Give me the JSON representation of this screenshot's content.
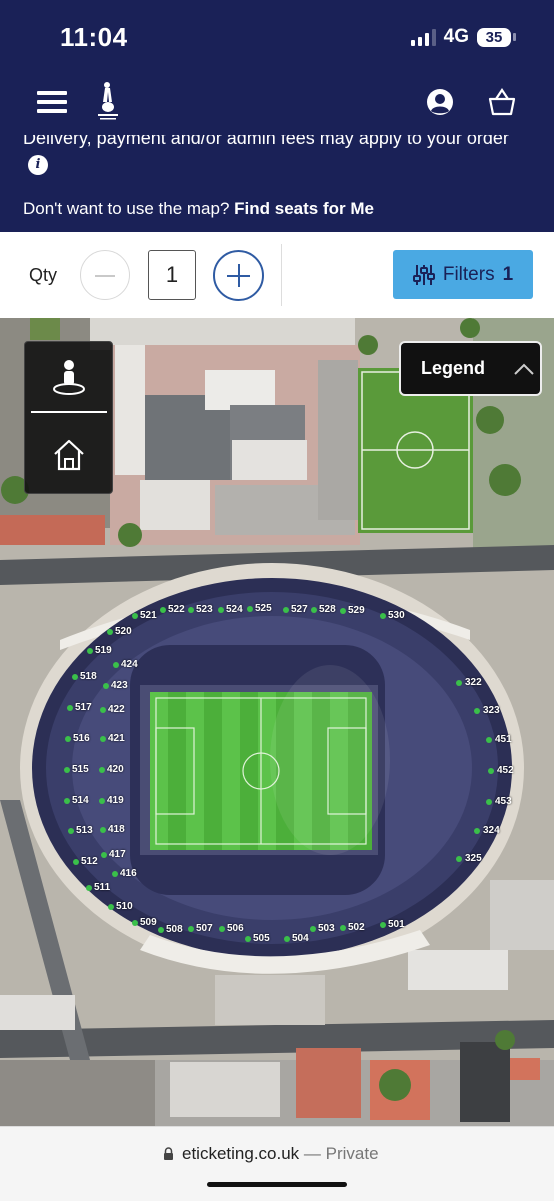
{
  "status_bar": {
    "time": "11:04",
    "network": "4G",
    "battery": "35"
  },
  "header": {
    "notice": "Delivery, payment and/or admin fees may apply to your order",
    "find_seats_prefix": "Don't want to use the map?",
    "find_seats_link": "Find seats for Me"
  },
  "quantity": {
    "label": "Qty",
    "value": "1"
  },
  "filters": {
    "label": "Filters",
    "count": "1"
  },
  "legend": {
    "label": "Legend"
  },
  "sections": [
    "521",
    "522",
    "523",
    "524",
    "525",
    "527",
    "528",
    "529",
    "530",
    "520",
    "519",
    "424",
    "518",
    "423",
    "517",
    "422",
    "516",
    "421",
    "515",
    "420",
    "514",
    "419",
    "513",
    "418",
    "417",
    "512",
    "416",
    "511",
    "510",
    "509",
    "508",
    "507",
    "506",
    "505",
    "504",
    "503",
    "502",
    "501",
    "322",
    "323",
    "451",
    "452",
    "453",
    "324",
    "325"
  ],
  "browser": {
    "domain": "eticketing.co.uk",
    "suffix": "— Private"
  },
  "colors": {
    "navy": "#1a2157",
    "accent_blue": "#4aa9e3",
    "plus_blue": "#2f5ba3",
    "available_green": "#3ac04a"
  }
}
